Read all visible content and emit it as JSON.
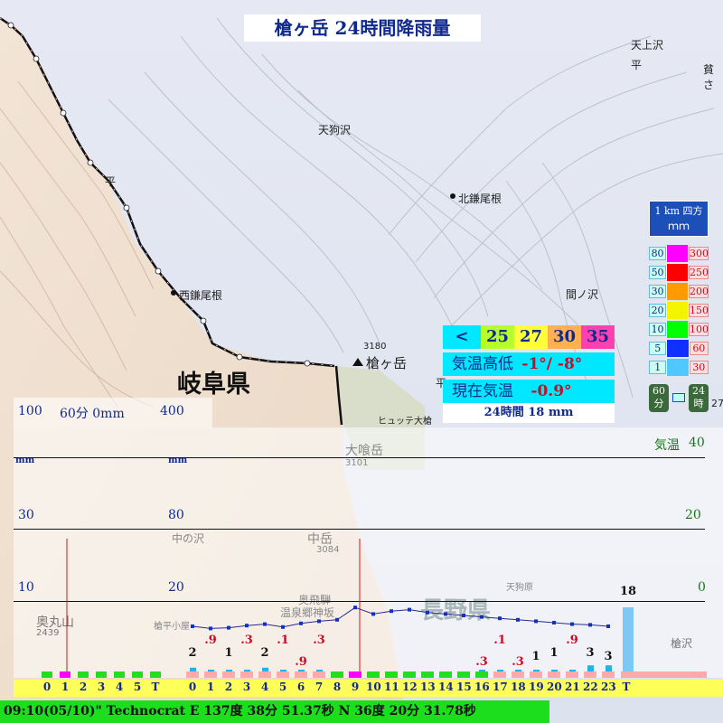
{
  "title": "槍ヶ岳 24時間降雨量",
  "map_labels": {
    "tenguzawa": "天狗沢",
    "kitakamaone": "北鎌尾根",
    "nishikamaone": "西鎌尾根",
    "mano_sawa": "間ノ沢",
    "tenjozawa": "天上沢",
    "yarigatake": "槍ヶ岳",
    "yari_elev": "3180",
    "hyutte": "ヒュッテ大槍",
    "oobami": "大喰岳",
    "oobami_elev": "3101",
    "nakadake": "中岳",
    "nakadake_elev": "3084",
    "nakanosawa": "中の沢",
    "okuhida": "奥飛騨",
    "onsenkyo": "温泉郷神坂",
    "okumaruyama": "奥丸山",
    "okumaruyama_elev": "2439",
    "yaridaira": "槍平小屋",
    "tengubara": "天狗原",
    "yarisawa": "槍沢",
    "gifu": "岐阜県",
    "nagano": "長野県",
    "hei1": "平",
    "hei2": "平",
    "hei3": "平",
    "kisho": "貧さ"
  },
  "scale_panel": {
    "header1": "1 km 四方",
    "header2": "ｍｍ",
    "left_values": [
      "80",
      "50",
      "30",
      "20",
      "10",
      "5",
      "1"
    ],
    "right_values": [
      "300",
      "250",
      "200",
      "150",
      "100",
      "60",
      "30"
    ],
    "colors": [
      "#ff00ff",
      "#ff0000",
      "#ff9a00",
      "#f4f400",
      "#00ff00",
      "#1030ff",
      "#4fc8ff"
    ],
    "foot_left": "60分",
    "foot_right": "24時",
    "edge": "27"
  },
  "temp_legend": {
    "lt": "<",
    "steps": [
      "25",
      "27",
      "30",
      "35"
    ],
    "step_colors": [
      "#b6ff2a",
      "#ffff3a",
      "#ffb050",
      "#ff40b0"
    ],
    "minmax_label": "気温高低",
    "minmax_value": "-1°/ -8°",
    "current_label": "現在気温",
    "current_value": "-0.9°",
    "total_24h": "24時間  18 mm"
  },
  "chart_header": {
    "left_max": "100",
    "min60_label": "60分 0mm",
    "right_max": "400",
    "temp_label": "気温",
    "temp_max": "40",
    "unit_left": "mm",
    "unit_right": "mm"
  },
  "axis": {
    "left_ticks": [
      "30",
      "10"
    ],
    "mid_ticks": [
      "80",
      "20"
    ],
    "temp_ticks": [
      "20",
      "0"
    ]
  },
  "chart_data": {
    "type": "bar",
    "categories_60min": [
      "0",
      "1",
      "2",
      "3",
      "4",
      "5",
      "T"
    ],
    "categories_24h": [
      "0",
      "1",
      "2",
      "3",
      "4",
      "5",
      "6",
      "7",
      "8",
      "9",
      "10",
      "11",
      "12",
      "13",
      "14",
      "15",
      "16",
      "17",
      "18",
      "19",
      "20",
      "21",
      "22",
      "23",
      "T"
    ],
    "hourly_rain_mm": [
      2,
      0.9,
      1,
      0.3,
      2,
      0.1,
      0.9,
      0.3,
      0,
      0,
      0,
      0,
      0,
      0,
      0,
      0,
      0.3,
      0.1,
      0.3,
      1,
      1,
      0.9,
      3,
      3
    ],
    "hourly_rain_labels": [
      "2",
      ".9",
      "1",
      ".3",
      "2",
      ".1",
      ".9",
      ".3",
      "",
      "",
      "",
      "",
      "",
      "",
      "",
      "",
      ".3",
      ".1",
      ".3",
      "1",
      "1",
      ".9",
      "3",
      "3"
    ],
    "total_mm": 18,
    "total_label": "18",
    "temperature": [
      -3.5,
      -3.8,
      -3.7,
      -3.4,
      -3.2,
      -3.6,
      -3.1,
      -2.8,
      -2.6,
      -0.9,
      -1.8,
      -1.4,
      -1.2,
      -1.6,
      -1.8,
      -2.0,
      -2.2,
      -2.4,
      -2.6,
      -2.8,
      -3.0,
      -3.2,
      -3.3,
      -3.5
    ],
    "temp_axis": {
      "min": 0,
      "max": 40
    },
    "rain_axis_left": {
      "max": 100
    },
    "rain_axis_right": {
      "max": 400
    }
  },
  "status_bar": "09:10(05/10)\" Technocrat    E  137度  38分  51.37秒   N 36度  20分  31.78秒"
}
